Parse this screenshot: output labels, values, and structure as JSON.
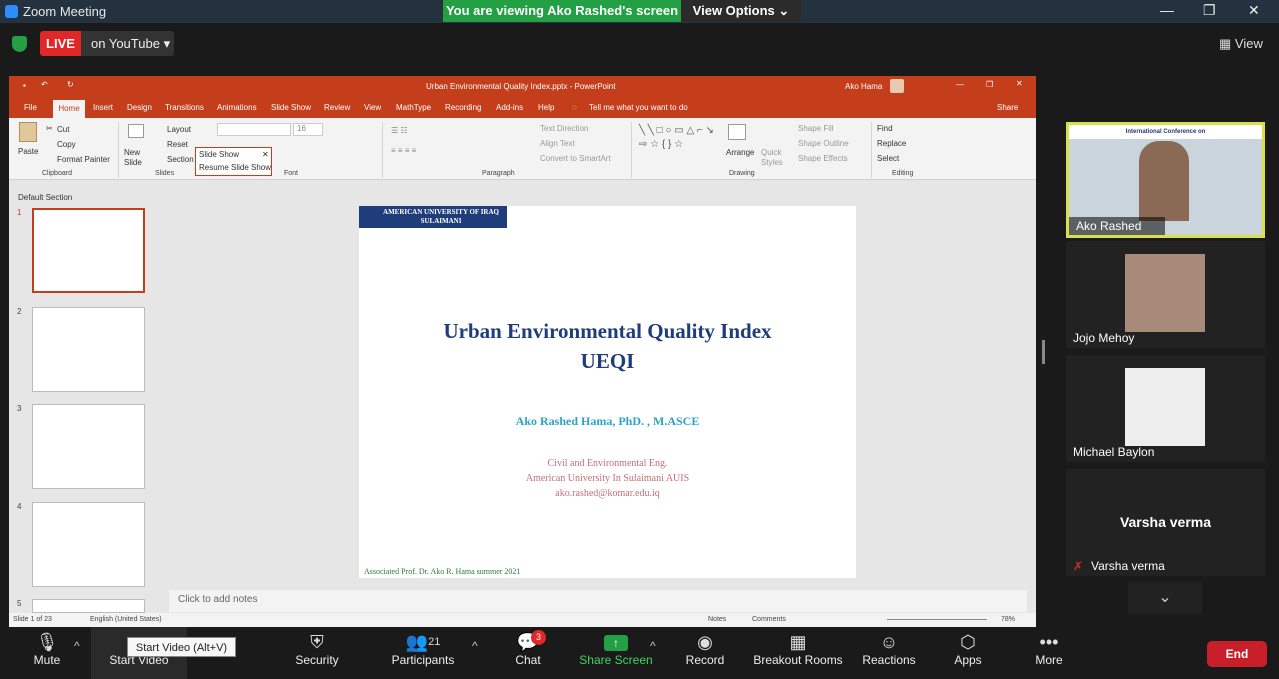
{
  "zoom": {
    "title": "Zoom Meeting",
    "viewing": "You are viewing Ako Rashed's screen",
    "view_options": "View Options",
    "live": "LIVE",
    "live_target": "on YouTube",
    "view": "View"
  },
  "ppt": {
    "file_title": "Urban Environmental Quality Index.pptx  -  PowerPoint",
    "user": "Ako Hama",
    "tabs": [
      "File",
      "Home",
      "Insert",
      "Design",
      "Transitions",
      "Animations",
      "Slide Show",
      "Review",
      "View",
      "MathType",
      "Recording",
      "Add-ins",
      "Help"
    ],
    "tell_me": "Tell me what you want to do",
    "share": "Share",
    "ribbon": {
      "paste": "Paste",
      "cut": "Cut",
      "copy": "Copy",
      "format_painter": "Format Painter",
      "clipboard": "Clipboard",
      "new_slide": "New Slide",
      "layout": "Layout",
      "reset": "Reset",
      "section": "Section",
      "slides": "Slides",
      "slide_show": "Slide Show",
      "resume": "Resume Slide Show",
      "font_size": "16",
      "font": "Font",
      "paragraph": "Paragraph",
      "text_direction": "Text Direction",
      "align_text": "Align Text",
      "convert_smartart": "Convert to SmartArt",
      "arrange": "Arrange",
      "quick_styles": "Quick Styles",
      "shape_fill": "Shape Fill",
      "shape_outline": "Shape Outline",
      "shape_effects": "Shape Effects",
      "drawing": "Drawing",
      "find": "Find",
      "replace": "Replace",
      "select": "Select",
      "editing": "Editing"
    },
    "default_section": "Default Section",
    "thumb_numbers": [
      "1",
      "2",
      "3",
      "4",
      "5"
    ],
    "slide": {
      "logo_line1": "AMERICAN UNIVERSITY OF IRAQ",
      "logo_line2": "SULAIMANI",
      "title_line1": "Urban Environmental Quality Index",
      "title_line2": "UEQI",
      "author": "Ako Rashed Hama, PhD. , M.ASCE",
      "dept1": "Civil and Environmental Eng.",
      "dept2": "American University In Sulaimani AUIS",
      "email": "ako.rashed@komar.edu.iq",
      "footer": "Associated  Prof. Dr. Ako R. Hama  summer   2021"
    },
    "notes_placeholder": "Click to add notes",
    "status": {
      "slide_of": "Slide 1 of 23",
      "language": "English (United States)",
      "notes": "Notes",
      "comments": "Comments",
      "zoom": "78%"
    }
  },
  "participants": [
    {
      "name": "Ako Rashed"
    },
    {
      "name": "Jojo Mehoy"
    },
    {
      "name": "Michael Baylon"
    },
    {
      "name": "Varsha verma"
    }
  ],
  "conference_banner": "International Conference on",
  "toolbar": {
    "mute": "Mute",
    "start_video": "Start Video",
    "tooltip": "Start Video (Alt+V)",
    "security": "Security",
    "participants": "Participants",
    "participants_count": "21",
    "chat": "Chat",
    "chat_badge": "3",
    "share_screen": "Share Screen",
    "record": "Record",
    "breakout": "Breakout Rooms",
    "reactions": "Reactions",
    "apps": "Apps",
    "more": "More",
    "end": "End"
  },
  "colors": {
    "ppt_red": "#c43e1c",
    "zoom_green": "#23a043",
    "end_red": "#c91f2b",
    "slide_title": "#1f3d7a"
  }
}
